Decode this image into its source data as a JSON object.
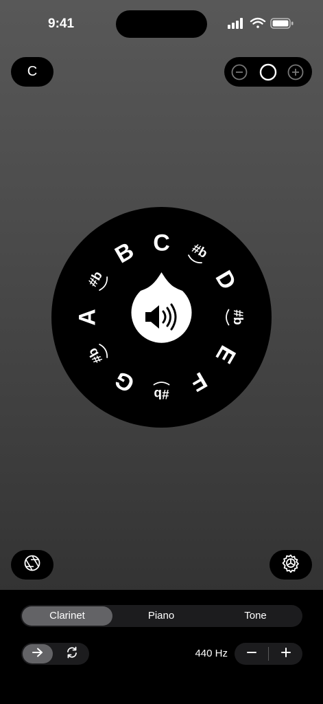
{
  "status_bar": {
    "time": "9:41"
  },
  "top": {
    "key_label": "C"
  },
  "wheel": {
    "notes": [
      {
        "label": "C",
        "kind": "natural"
      },
      {
        "label": "#b",
        "kind": "accidental"
      },
      {
        "label": "D",
        "kind": "natural"
      },
      {
        "label": "#b",
        "kind": "accidental"
      },
      {
        "label": "E",
        "kind": "natural"
      },
      {
        "label": "F",
        "kind": "natural"
      },
      {
        "label": "#b",
        "kind": "accidental"
      },
      {
        "label": "G",
        "kind": "natural"
      },
      {
        "label": "#b",
        "kind": "accidental"
      },
      {
        "label": "A",
        "kind": "natural"
      },
      {
        "label": "#b",
        "kind": "accidental"
      },
      {
        "label": "B",
        "kind": "natural"
      }
    ],
    "center_icon": "speaker-icon"
  },
  "bottom_panel": {
    "instruments": [
      "Clarinet",
      "Piano",
      "Tone"
    ],
    "selected_instrument": "Clarinet",
    "frequency": "440 Hz"
  },
  "icons": {
    "left": "aperture-icon",
    "right": "gear-icon",
    "volume": [
      "minus-circle-icon",
      "circle-icon",
      "plus-circle-icon"
    ],
    "mode": [
      "arrow-right-icon",
      "repeat-icon"
    ]
  }
}
